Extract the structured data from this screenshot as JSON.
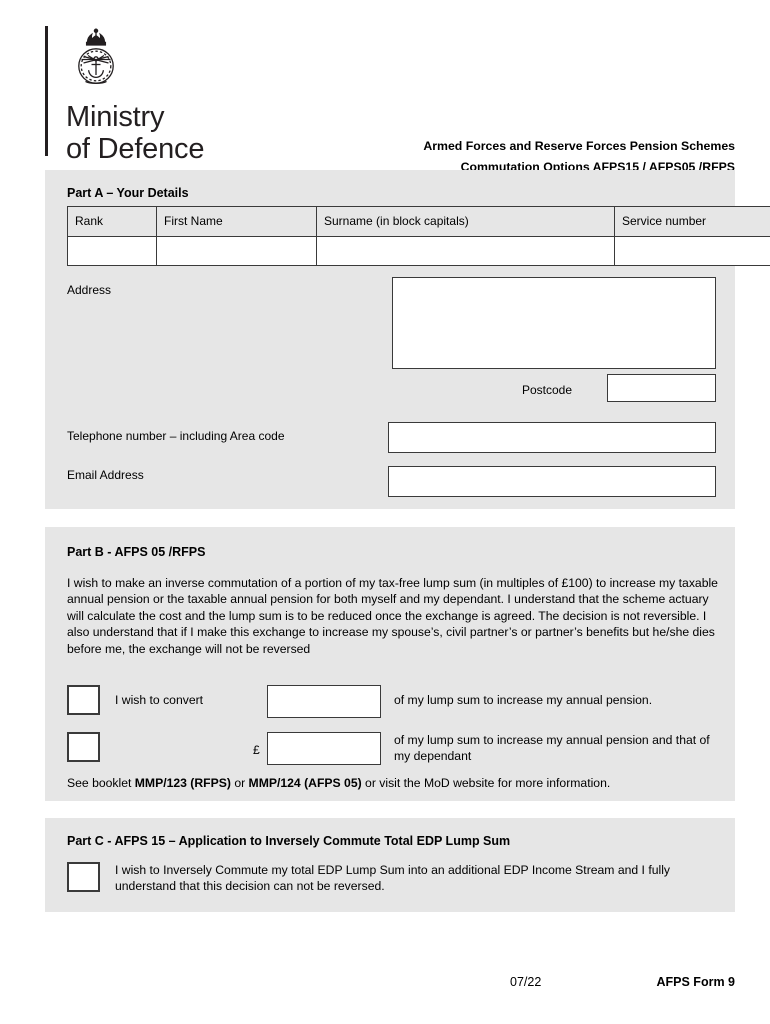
{
  "masthead": {
    "crest_icon": "mod-crest-icon",
    "wordmark_line1": "Ministry",
    "wordmark_line2": "of Defence",
    "scheme_title_1": "Armed Forces and Reserve Forces Pension Schemes",
    "scheme_title_2": "Commutation Options AFPS15 / AFPS05 /RFPS"
  },
  "part_a": {
    "heading": "Part A – Your Details",
    "table": {
      "headers": [
        "Rank",
        "First Name",
        "Surname (in block capitals)",
        "Service number"
      ],
      "rows": [
        [
          "",
          "",
          "",
          ""
        ]
      ]
    },
    "address_label": "Address",
    "address_value": "",
    "postcode_label": "Postcode",
    "postcode_value": "",
    "telephone_label": "Telephone number – including Area code",
    "telephone_value": "",
    "email_label": "Email Address",
    "email_value": ""
  },
  "part_b": {
    "heading": "Part B - AFPS 05 /RFPS",
    "body": "I wish to make an inverse commutation of a portion of my tax-free lump sum (in multiples of £100) to increase my taxable annual pension or the taxable annual pension for both myself and my dependant. I understand that the scheme actuary will calculate the cost and the lump sum is to be reduced once the exchange is agreed. The decision is not reversible. I also understand that if I make this exchange to increase my spouse’s, civil partner’s or partner’s benefits but he/she dies before me, the exchange will not be reversed",
    "option1": {
      "checkbox_checked": "",
      "label": "I wish to convert",
      "amount_value": "",
      "after_text": "of my lump sum to increase my annual pension."
    },
    "option2": {
      "checkbox_checked": "",
      "currency_symbol": "£",
      "amount_value": "",
      "after_text": "of my lump sum to increase my annual pension and that of my dependant"
    },
    "booklet_note_1": "See booklet ",
    "booklet_ref_1": "MMP/123 (RFPS)",
    "booklet_note_2": " or ",
    "booklet_ref_2": "MMP/124 (AFPS 05)",
    "booklet_note_3": " or visit the MoD website for more information."
  },
  "part_c": {
    "heading": "Part C - AFPS 15 – Application to Inversely Commute Total EDP Lump Sum",
    "checkbox_checked": "",
    "text": "I wish to Inversely Commute my total EDP Lump Sum into an additional EDP Income Stream and I fully understand that this decision can not be reversed."
  },
  "footer": {
    "date": "07/22",
    "form_number": "AFPS Form 9"
  },
  "colors": {
    "panel_background": "#e6e6e6",
    "page_background": "#ffffff",
    "border": "#3a3a3a",
    "text": "#000000",
    "logo": "#231f20"
  }
}
